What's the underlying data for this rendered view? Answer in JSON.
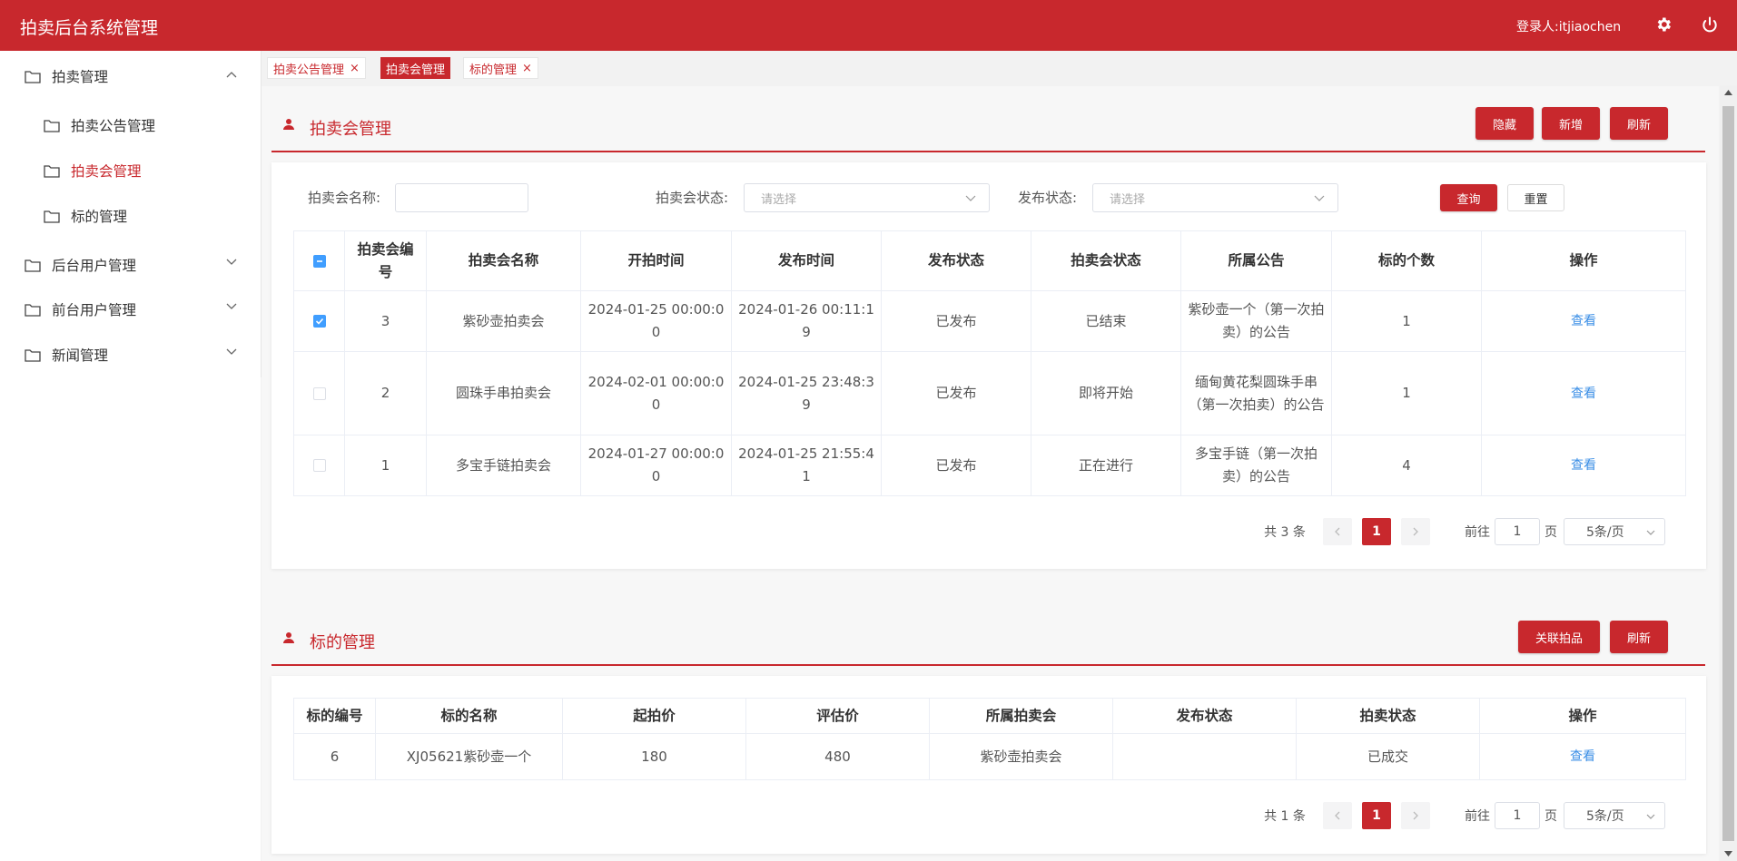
{
  "app": {
    "title": "拍卖后台系统管理",
    "user_label": "登录人:itjiaochen"
  },
  "icons": {
    "settings": "gear-icon",
    "power": "power-icon"
  },
  "colors": {
    "brand": "#c8282d",
    "link": "#3a8ee6",
    "checkbox": "#409eff"
  },
  "sidebar": {
    "items": [
      {
        "label": "拍卖管理",
        "expanded": true
      },
      {
        "label": "拍卖公告管理"
      },
      {
        "label": "拍卖会管理",
        "active": true
      },
      {
        "label": "标的管理"
      },
      {
        "label": "后台用户管理",
        "expanded": false
      },
      {
        "label": "前台用户管理",
        "expanded": false
      },
      {
        "label": "新闻管理",
        "expanded": false
      }
    ]
  },
  "tabs": [
    {
      "label": "拍卖公告管理",
      "close": "×"
    },
    {
      "label": "拍卖会管理"
    },
    {
      "label": "标的管理",
      "close": "×"
    }
  ],
  "auction_section": {
    "title": "拍卖会管理",
    "buttons": {
      "hide": "隐藏",
      "add": "新增",
      "refresh": "刷新"
    },
    "filters": {
      "name_label": "拍卖会名称:",
      "name_value": "",
      "status_label": "拍卖会状态:",
      "status_placeholder": "请选择",
      "publish_label": "发布状态:",
      "publish_placeholder": "请选择",
      "query": "查询",
      "reset": "重置"
    },
    "columns": [
      "拍卖会编号",
      "拍卖会名称",
      "开拍时间",
      "发布时间",
      "发布状态",
      "拍卖会状态",
      "所属公告",
      "标的个数",
      "操作"
    ],
    "rows": [
      {
        "checked": true,
        "id": "3",
        "name": "紫砂壶拍卖会",
        "start": "2024-01-25 00:00:00",
        "publish": "2024-01-26 00:11:19",
        "pub_status": "已发布",
        "status": "已结束",
        "notice": "紫砂壶一个（第一次拍卖）的公告",
        "count": "1",
        "action": "查看"
      },
      {
        "checked": false,
        "id": "2",
        "name": "圆珠手串拍卖会",
        "start": "2024-02-01 00:00:00",
        "publish": "2024-01-25 23:48:39",
        "pub_status": "已发布",
        "status": "即将开始",
        "notice": "缅甸黄花梨圆珠手串（第一次拍卖）的公告",
        "count": "1",
        "action": "查看"
      },
      {
        "checked": false,
        "id": "1",
        "name": "多宝手链拍卖会",
        "start": "2024-01-27 00:00:00",
        "publish": "2024-01-25 21:55:41",
        "pub_status": "已发布",
        "status": "正在进行",
        "notice": "多宝手链（第一次拍卖）的公告",
        "count": "4",
        "action": "查看"
      }
    ],
    "pager": {
      "total": "共 3 条",
      "page": "1",
      "goto": "前往",
      "page_input": "1",
      "page_unit": "页",
      "size": "5条/页"
    }
  },
  "target_section": {
    "title": "标的管理",
    "buttons": {
      "link": "关联拍品",
      "refresh": "刷新"
    },
    "columns": [
      "标的编号",
      "标的名称",
      "起拍价",
      "评估价",
      "所属拍卖会",
      "发布状态",
      "拍卖状态",
      "操作"
    ],
    "rows": [
      {
        "id": "6",
        "name": "XJ05621紫砂壶一个",
        "start_price": "180",
        "eval_price": "480",
        "auction": "紫砂壶拍卖会",
        "pub_status": "",
        "status": "已成交",
        "action": "查看"
      }
    ],
    "pager": {
      "total": "共 1 条",
      "page": "1",
      "goto": "前往",
      "page_input": "1",
      "page_unit": "页",
      "size": "5条/页"
    }
  }
}
